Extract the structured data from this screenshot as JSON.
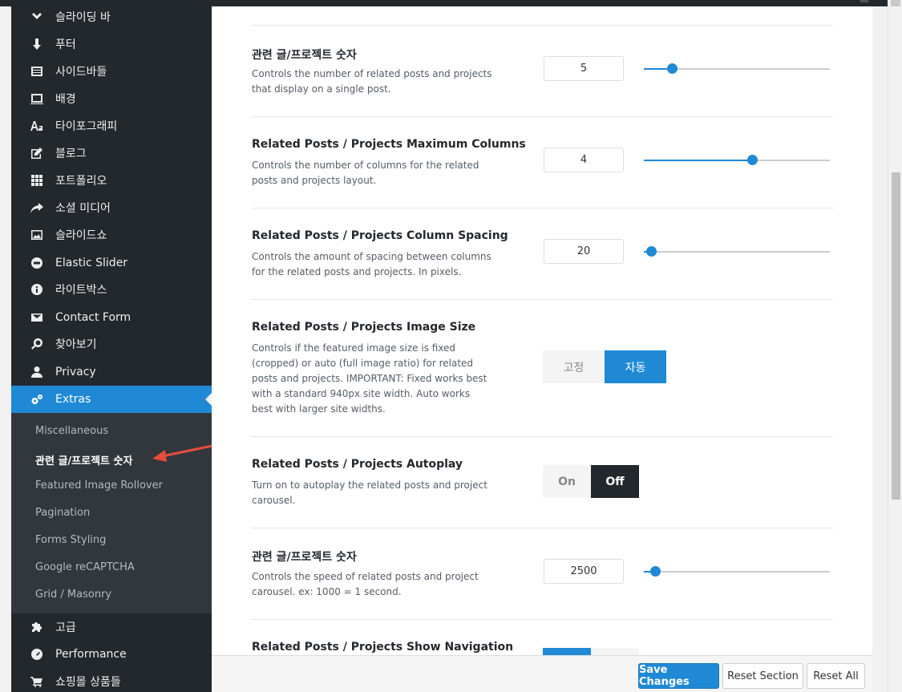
{
  "sidebar": {
    "items": [
      {
        "label": "슬라이딩 바",
        "icon": "chevron-down-icon"
      },
      {
        "label": "푸터",
        "icon": "arrow-down-icon"
      },
      {
        "label": "사이드바들",
        "icon": "sidebar-icon"
      },
      {
        "label": "배경",
        "icon": "monitor-icon"
      },
      {
        "label": "타이포그래피",
        "icon": "typography-icon"
      },
      {
        "label": "블로그",
        "icon": "edit-icon"
      },
      {
        "label": "포트폴리오",
        "icon": "grid-icon"
      },
      {
        "label": "소셜 미디어",
        "icon": "share-icon"
      },
      {
        "label": "슬라이드쇼",
        "icon": "image-icon"
      },
      {
        "label": "Elastic Slider",
        "icon": "slider-icon"
      },
      {
        "label": "라이트박스",
        "icon": "info-icon"
      },
      {
        "label": "Contact Form",
        "icon": "envelope-icon"
      },
      {
        "label": "찾아보기",
        "icon": "search-icon"
      },
      {
        "label": "Privacy",
        "icon": "user-icon"
      },
      {
        "label": "Extras",
        "icon": "gears-icon"
      }
    ],
    "submenu": [
      {
        "label": "Miscellaneous"
      },
      {
        "label": "관련 글/프로젝트 숫자"
      },
      {
        "label": "Featured Image Rollover"
      },
      {
        "label": "Pagination"
      },
      {
        "label": "Forms Styling"
      },
      {
        "label": "Google reCAPTCHA"
      },
      {
        "label": "Grid / Masonry"
      }
    ],
    "bottom_items": [
      {
        "label": "고급",
        "icon": "puzzle-icon"
      },
      {
        "label": "Performance",
        "icon": "performance-icon"
      },
      {
        "label": "쇼핑몰 상품들",
        "icon": "cart-icon"
      }
    ]
  },
  "options": [
    {
      "title": "관련 글/프로젝트 숫자",
      "desc": "Controls the number of related posts and projects that display on a single post.",
      "value": "5",
      "slider_fraction": 0.15
    },
    {
      "title": "Related Posts / Projects Maximum Columns",
      "desc": "Controls the number of columns for the related posts and projects layout.",
      "value": "4",
      "slider_fraction": 0.58
    },
    {
      "title": "Related Posts / Projects Column Spacing",
      "desc": "Controls the amount of spacing between columns for the related posts and projects. In pixels.",
      "value": "20",
      "slider_fraction": 0.04
    },
    {
      "title": "Related Posts / Projects Image Size",
      "desc": "Controls if the featured image size is fixed (cropped) or auto (full image ratio) for related posts and projects. IMPORTANT: Fixed works best with a standard 940px site width. Auto works best with larger site widths.",
      "choices": [
        "고정",
        "자동"
      ],
      "selected": "자동"
    },
    {
      "title": "Related Posts / Projects Autoplay",
      "desc": "Turn on to autoplay the related posts and project carousel.",
      "choices": [
        "On",
        "Off"
      ],
      "selected": "Off"
    },
    {
      "title": "관련 글/프로젝트 숫자",
      "desc": "Controls the speed of related posts and project carousel. ex: 1000 = 1 second.",
      "value": "2500",
      "slider_fraction": 0.06
    },
    {
      "title": "Related Posts / Projects Show Navigation"
    }
  ],
  "footer": {
    "save": "Save Changes",
    "reset_section": "Reset Section",
    "reset_all": "Reset All"
  },
  "colors": {
    "accent": "#1f89d6",
    "sidebar_bg": "#23282d",
    "submenu_bg": "#32373c",
    "arrow": "#e74c3c"
  }
}
